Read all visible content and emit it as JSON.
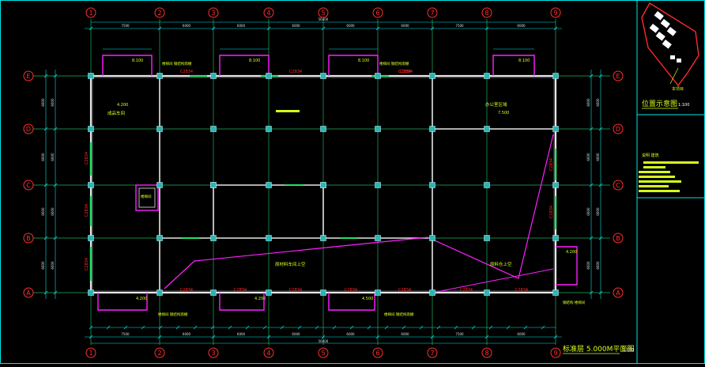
{
  "drawing": {
    "plan_title": "标准层 5.000M平面图",
    "plan_scale": "1:100",
    "location_title": "位置示意图",
    "location_scale": "1:100",
    "location_marker": "本项目"
  },
  "grid": {
    "columns": [
      "1",
      "2",
      "3",
      "4",
      "5",
      "6",
      "7",
      "8",
      "9"
    ],
    "rows": [
      "E",
      "D",
      "C",
      "B",
      "A"
    ]
  },
  "dimensions": {
    "overall": "56400",
    "top_segments": [
      "7500",
      "6000",
      "6000",
      "6000",
      "6000",
      "6000",
      "7500",
      "6000"
    ],
    "bottom_segments": [
      "7500",
      "6000",
      "6000",
      "6000",
      "6000",
      "6000",
      "7500",
      "6000"
    ],
    "left_segments": [
      "6600",
      "6600",
      "6600",
      "6600"
    ],
    "right_segments": [
      "6600",
      "6600",
      "6600",
      "6600"
    ],
    "edge_small": "700"
  },
  "rooms": {
    "upper_left": "成品车间",
    "upper_right": "办公室区域",
    "lower_mid": "原材料车间上空",
    "lower_right": "原料仓上空",
    "stair": "楼梯间"
  },
  "levels": {
    "ul": "4.200",
    "ur": "7.500",
    "top1": "8.100",
    "top2": "8.100",
    "top3": "8.100",
    "top4": "8.100",
    "bot1": "4.200",
    "bot2": "4.200",
    "bot3": "4.500",
    "right": "4.200"
  },
  "openings": {
    "top": [
      "C2834",
      "C2834",
      "C2834",
      "C2834"
    ],
    "bottom": [
      "C2834",
      "C2834",
      "C2834",
      "C2834",
      "C2834",
      "C2834",
      "C2834"
    ],
    "left": [
      "C2834",
      "C2834",
      "C2834"
    ],
    "right": [
      "C2834",
      "C2834"
    ]
  },
  "notes": {
    "legend_code": "说明 建筑",
    "legend_lines": [
      "",
      "",
      "",
      "",
      ""
    ],
    "top_note": "楼梯间 钢结构雨棚",
    "bottom_note": "楼梯间 钢结构雨棚",
    "right_note": "钢结构 楼梯间"
  },
  "colors": {
    "frame": "#00E5E5",
    "grid_bubble": "#FF3030",
    "wall": "#E6E6E6",
    "dim_line": "#00E5E5",
    "label": "#D7FF1A",
    "opening": "#FF2A2A",
    "magenta": "#FF20FF",
    "column": "#2BB5B5"
  }
}
